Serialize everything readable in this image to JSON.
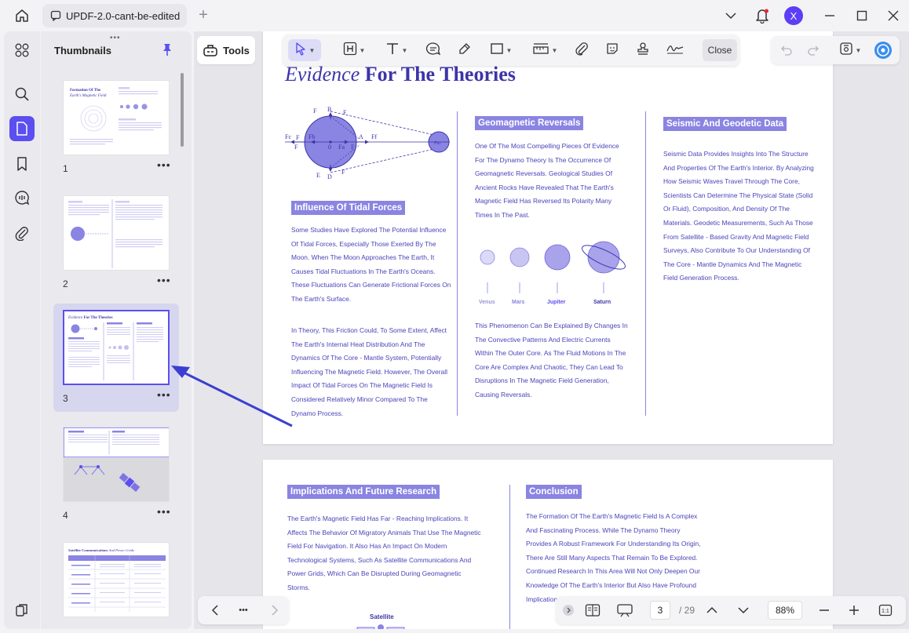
{
  "window": {
    "tab_title": "UPDF-2.0-cant-be-edited",
    "avatar_letter": "X",
    "accent": "#5b4ff0"
  },
  "rail": {
    "items": [
      {
        "icon": "grid-icon"
      },
      {
        "icon": "search-icon"
      },
      {
        "icon": "page-icon",
        "active": true
      },
      {
        "icon": "bookmark-icon"
      },
      {
        "icon": "comment-icon"
      },
      {
        "icon": "attachment-icon"
      }
    ],
    "bottom_icon": "layers-icon"
  },
  "thumbnails": {
    "title": "Thumbnails",
    "grip": "•••",
    "more": "•••",
    "items": [
      {
        "number": "1",
        "mini_title": "Formation Of The Earth's Magnetic Field"
      },
      {
        "number": "2",
        "mini_title": ""
      },
      {
        "number": "3",
        "mini_title": "Evidence For The Theories",
        "selected": true
      },
      {
        "number": "4",
        "mini_title": ""
      },
      {
        "number": "5",
        "mini_title": "Satellite Communications And Power Grids"
      }
    ]
  },
  "toolbar": {
    "tools_label": "Tools",
    "close_label": "Close"
  },
  "document": {
    "title_italic": "Evidence",
    "title_rest": " For The Theories",
    "diagram": {
      "labels": [
        "B",
        "F",
        "F",
        "Fc",
        "Fb",
        "F",
        "A",
        "Ff",
        "0",
        "Fa",
        "D",
        "E",
        "F",
        "F",
        "F",
        "Fm"
      ]
    },
    "tidal": {
      "heading": "Influence Of Tidal Forces",
      "para1": "Some Studies Have Explored The Potential Influence Of Tidal Forces, Especially Those Exerted By The Moon. When The Moon Approaches The Earth, It Causes Tidal Fluctuations In The Earth's Oceans. These Fluctuations Can Generate Frictional Forces On The Earth's Surface.",
      "para2": "In Theory, This Friction Could, To Some Extent, Affect The Earth's Internal Heat Distribution And The Dynamics Of The Core - Mantle System, Potentially Influencing The Magnetic Field. However, The Overall Impact Of Tidal Forces On The Magnetic Field Is Considered Relatively Minor Compared To The Dynamo Process."
    },
    "geomagnetic": {
      "heading": "Geomagnetic Reversals",
      "para1": "One Of The Most Compelling Pieces Of Evidence For The Dynamo Theory Is The Occurrence Of Geomagnetic Reversals. Geological Studies Of Ancient Rocks Have Revealed That The Earth's Magnetic Field Has Reversed Its Polarity Many Times In The Past.",
      "planets": [
        "Venus",
        "Mars",
        "Jupiter",
        "Saturn"
      ],
      "para2": "This Phenomenon Can Be Explained By Changes In The Convective Patterns And Electric Currents Within The Outer Core. As The Fluid Motions In The Core Are Complex And Chaotic, They Can Lead To Disruptions In The Magnetic Field Generation, Causing Reversals."
    },
    "seismic": {
      "heading": "Seismic And Geodetic Data",
      "para": "Seismic Data Provides Insights Into The Structure And Properties Of The Earth's Interior. By Analyzing How Seismic Waves Travel Through The Core, Scientists Can Determine The Physical State (Solid Or Fluid), Composition, And Density Of The Materials. Geodetic Measurements, Such As Those From Satellite - Based Gravity And Magnetic Field Surveys, Also Contribute To Our Understanding Of The Core - Mantle Dynamics And The Magnetic Field Generation Process."
    },
    "implications": {
      "heading": "Implications And Future Research",
      "para": "The Earth's Magnetic Field Has Far - Reaching Implications. It Affects The Behavior Of Migratory Animals That Use The Magnetic Field For Navigation. It Also Has An Impact On Modern Technological Systems, Such As Satellite Communications And Power Grids, Which Can Be Disrupted During Geomagnetic Storms.",
      "figure_label": "Satellite"
    },
    "conclusion": {
      "heading": "Conclusion",
      "para": "The Formation Of The Earth's Magnetic Field Is A Complex And Fascinating Process. While The Dynamo Theory Provides A Robust Framework For Understanding Its Origin, There Are Still Many Aspects That Remain To Be Explored. Continued Research In This Area Will Not Only Deepen Our Knowledge Of The Earth's Interior But Also Have Profound Implications For Our Understanding Of The Universe."
    }
  },
  "bottom_nav": {
    "more": "•••",
    "current_page": "3",
    "total_pages": "/ 29",
    "zoom": "88%"
  }
}
